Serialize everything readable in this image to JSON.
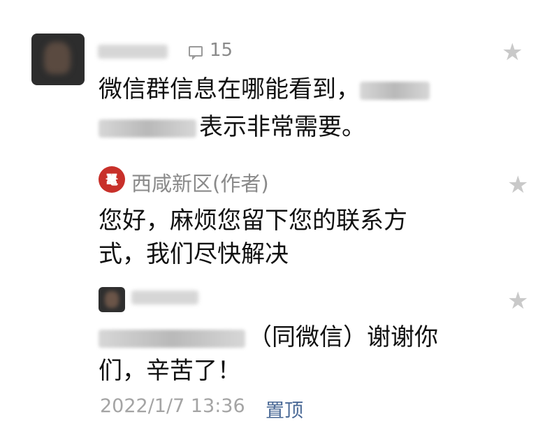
{
  "comments": [
    {
      "author_blurred": true,
      "like_count": "15",
      "text_line1": "微信群信息在哪能看到，",
      "text_line2": "表示非常需要。"
    },
    {
      "author_name": "西咸新区(作者)",
      "text_line1": "您好，麻烦您留下您的联系方",
      "text_line2": "式，我们尽快解决"
    },
    {
      "author_blurred": true,
      "text_line1": "（同微信）谢谢你",
      "text_line2": "们，辛苦了！",
      "timestamp": "2022/1/7 13:36",
      "pin_label": "置顶"
    }
  ],
  "icons": {
    "star": "★",
    "author_badge_glyph": "鼍"
  },
  "colors": {
    "name": "#8a8a8a",
    "body": "#111111",
    "star": "#c9c9c9",
    "author_badge": "#c8302a",
    "pin_link": "#4a6996",
    "timestamp": "#a4a4a4"
  }
}
